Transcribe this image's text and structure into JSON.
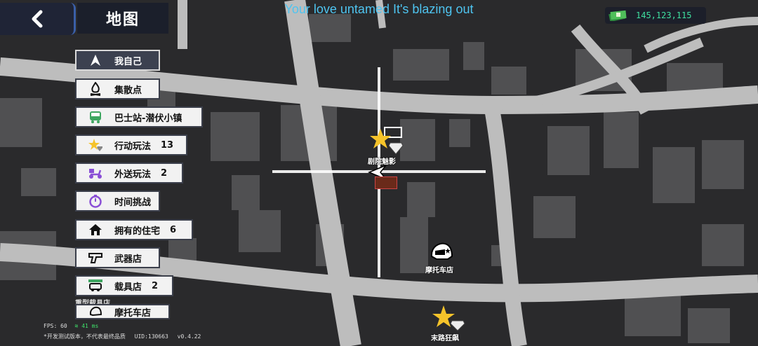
{
  "header": {
    "title": "地图",
    "back_icon": "chevron-left-icon"
  },
  "now_playing": "Your love untamed It's blazing out",
  "money": {
    "amount": "145,123,115",
    "icon": "cash-stack-icon"
  },
  "menu": [
    {
      "label": "我自己",
      "icon": "player-arrow-icon",
      "count": "",
      "selected": true
    },
    {
      "label": "集散点",
      "icon": "campfire-icon",
      "count": ""
    },
    {
      "label": "巴士站-潜伏小镇",
      "icon": "bus-icon",
      "count": ""
    },
    {
      "label": "行动玩法",
      "icon": "star-diamond-icon",
      "count": "13"
    },
    {
      "label": "外送玩法",
      "icon": "delivery-scooter-icon",
      "count": "2"
    },
    {
      "label": "时间挑战",
      "icon": "stopwatch-icon",
      "count": ""
    },
    {
      "label": "拥有的住宅",
      "icon": "house-icon",
      "count": "6"
    },
    {
      "label": "武器店",
      "icon": "pistol-icon",
      "count": ""
    },
    {
      "label": "载具店",
      "icon": "vehicle-shop-icon",
      "count": "2"
    },
    {
      "label": "摩托车店",
      "icon": "helmet-icon",
      "count": ""
    }
  ],
  "hidden_label": "重型载具店",
  "markers": {
    "theater": "剧院魅影",
    "moto_shop": "摩托车店",
    "last_road": "末路狂飙"
  },
  "debug": {
    "fps": "FPS: 60",
    "ping": "41 ms",
    "build_note": "*开发测试版本，不代表最终品质",
    "uid": "UID:130663",
    "version": "v0.4.22"
  },
  "colors": {
    "accent": "#4ec4f0",
    "money": "#3fe0a0",
    "road": "#bdbdbd",
    "block": "#505052",
    "ground": "#2a2a2c"
  }
}
